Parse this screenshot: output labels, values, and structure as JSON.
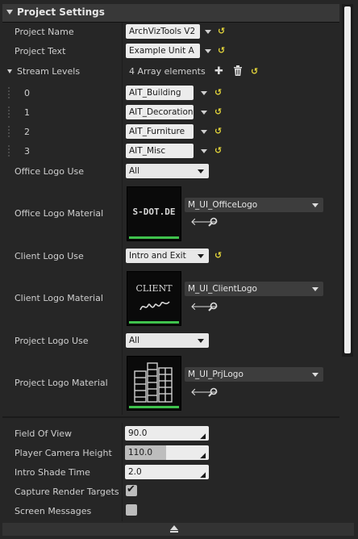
{
  "header": {
    "title": "Project Settings"
  },
  "project": {
    "project_name_label": "Project Name",
    "project_name_value": "ArchVizTools V2",
    "project_text_label": "Project Text",
    "project_text_value": "Example Unit A",
    "stream_levels_label": "Stream Levels",
    "stream_levels_count": "4 Array elements",
    "stream_levels": [
      {
        "index": "0",
        "value": "AIT_Building"
      },
      {
        "index": "1",
        "value": "AIT_Decoration"
      },
      {
        "index": "2",
        "value": "AIT_Furniture"
      },
      {
        "index": "3",
        "value": "AIT_Misc"
      }
    ],
    "office_logo_use_label": "Office Logo Use",
    "office_logo_use_value": "All",
    "office_logo_material_label": "Office Logo Material",
    "office_logo_material_value": "M_UI_OfficeLogo",
    "office_logo_thumb_text": "S-DOT.DE",
    "client_logo_use_label": "Client Logo Use",
    "client_logo_use_value": "Intro and Exit",
    "client_logo_material_label": "Client Logo Material",
    "client_logo_material_value": "M_UI_ClientLogo",
    "client_logo_thumb_text": "CLIENT",
    "project_logo_use_label": "Project Logo Use",
    "project_logo_use_value": "All",
    "project_logo_material_label": "Project Logo Material",
    "project_logo_material_value": "M_UI_PrjLogo"
  },
  "camera": {
    "fov_label": "Field Of View",
    "fov_value": "90.0",
    "height_label": "Player Camera Height",
    "height_value": "110.0",
    "height_fill": 0.49,
    "intro_shade_label": "Intro Shade Time",
    "intro_shade_value": "2.0",
    "capture_label": "Capture Render Targets",
    "capture_checked": true,
    "screen_messages_label": "Screen Messages",
    "screen_messages_checked": false
  },
  "icons": {
    "reset": "reset-arrow-icon",
    "add": "plus-icon",
    "delete": "trash-icon",
    "use_selected": "back-arrow-icon",
    "browse": "search-icon"
  },
  "colors": {
    "accent_green": "#3fc24d",
    "reset_yellow": "#e0d23a"
  }
}
